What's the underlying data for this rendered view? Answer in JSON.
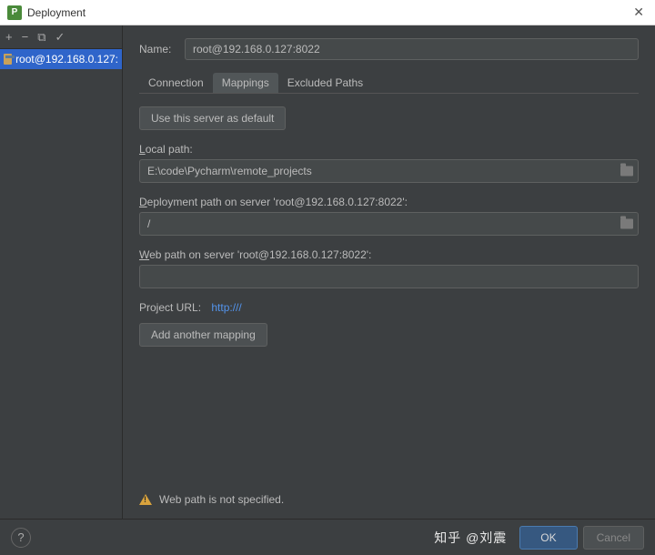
{
  "window": {
    "title": "Deployment",
    "app_icon_letter": "P"
  },
  "toolbar": {
    "add": "+",
    "remove": "−",
    "copy": "⧉",
    "check": "✓"
  },
  "sidebar": {
    "items": [
      {
        "label": "root@192.168.0.127:"
      }
    ]
  },
  "main": {
    "name_label": "Name:",
    "name_value": "root@192.168.0.127:8022",
    "tabs": [
      {
        "label": "Connection",
        "active": false
      },
      {
        "label": "Mappings",
        "active": true
      },
      {
        "label": "Excluded Paths",
        "active": false
      }
    ],
    "use_default_btn": "Use this server as default",
    "local_path_label_prefix": "L",
    "local_path_label_rest": "ocal path:",
    "local_path_value": "E:\\code\\Pycharm\\remote_projects",
    "deployment_path_label_prefix": "D",
    "deployment_path_label_rest": "eployment path on server 'root@192.168.0.127:8022':",
    "deployment_path_value": "/",
    "web_path_label_prefix": "W",
    "web_path_label_rest": "eb path on server 'root@192.168.0.127:8022':",
    "web_path_value": "",
    "project_url_label": "Project URL:",
    "project_url_value": "http:///",
    "add_mapping_btn": "Add another mapping",
    "warning_text": "Web path is not specified."
  },
  "footer": {
    "help": "?",
    "watermark": "知乎 @刘震",
    "ok": "OK",
    "cancel": "Cancel"
  }
}
